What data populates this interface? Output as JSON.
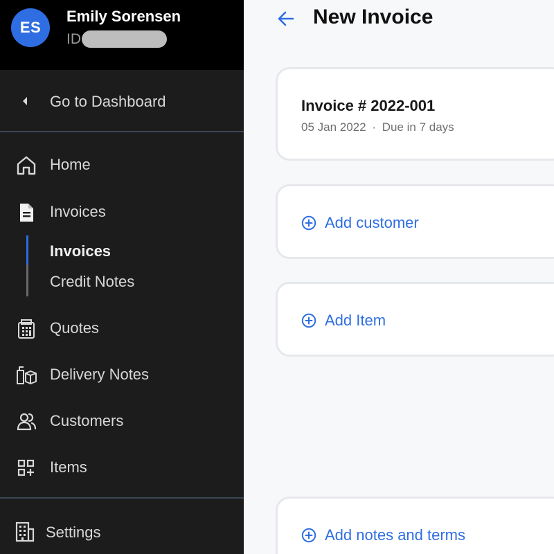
{
  "user": {
    "initials": "ES",
    "name": "Emily Sorensen",
    "id_label": "ID"
  },
  "sidebar": {
    "dashboard_link": "Go to Dashboard",
    "items": [
      {
        "label": "Home",
        "icon": "home-icon"
      },
      {
        "label": "Invoices",
        "icon": "document-icon"
      },
      {
        "label": "Quotes",
        "icon": "calculator-icon"
      },
      {
        "label": "Delivery Notes",
        "icon": "boxes-icon"
      },
      {
        "label": "Customers",
        "icon": "users-icon"
      },
      {
        "label": "Items",
        "icon": "grid-plus-icon"
      }
    ],
    "sub_items": [
      {
        "label": "Invoices",
        "active": true
      },
      {
        "label": "Credit Notes",
        "active": false
      }
    ],
    "settings": {
      "label": "Settings",
      "icon": "building-icon"
    }
  },
  "main": {
    "title": "New Invoice",
    "invoice": {
      "number": "Invoice # 2022-001",
      "date": "05 Jan 2022",
      "separator": "·",
      "due": "Due in 7 days"
    },
    "add_customer": "Add customer",
    "add_item": "Add Item",
    "add_notes": "Add notes and terms"
  },
  "colors": {
    "accent": "#2f6ee2",
    "sidebar_bg": "#1c1c1c",
    "profile_bg": "#000000",
    "page_bg": "#f7f8fa"
  }
}
